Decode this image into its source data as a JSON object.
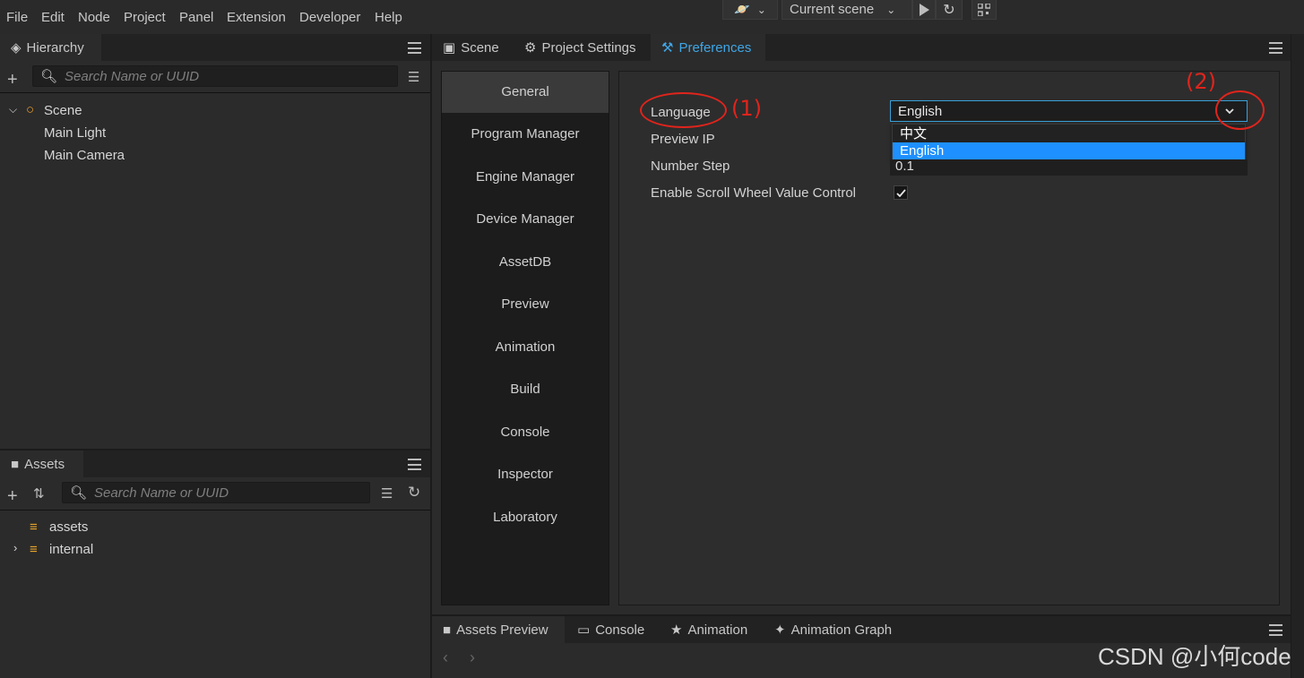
{
  "menubar": {
    "items": [
      "File",
      "Edit",
      "Node",
      "Project",
      "Panel",
      "Extension",
      "Developer",
      "Help"
    ]
  },
  "toolbar": {
    "scene_select": "Current scene"
  },
  "hierarchy": {
    "tab": "Hierarchy",
    "search_placeholder": "Search Name or UUID",
    "tree": [
      {
        "label": "Scene"
      },
      {
        "label": "Main Light"
      },
      {
        "label": "Main Camera"
      }
    ]
  },
  "assets": {
    "tab": "Assets",
    "search_placeholder": "Search Name or UUID",
    "tree": [
      {
        "label": "assets"
      },
      {
        "label": "internal"
      }
    ]
  },
  "center_tabs": [
    "Scene",
    "Project Settings",
    "Preferences"
  ],
  "preferences": {
    "nav": [
      "General",
      "Program Manager",
      "Engine Manager",
      "Device Manager",
      "AssetDB",
      "Preview",
      "Animation",
      "Build",
      "Console",
      "Inspector",
      "Laboratory"
    ],
    "active_nav": "General",
    "fields": {
      "language_label": "Language",
      "language_value": "English",
      "language_options": [
        "中文",
        "English"
      ],
      "preview_ip_label": "Preview IP",
      "number_step_label": "Number Step",
      "number_step_value": "0.1",
      "scroll_label": "Enable Scroll Wheel Value Control",
      "scroll_checked": true
    }
  },
  "annotations": {
    "a1": "(1)",
    "a2": "(2)",
    "color": "#e0241c"
  },
  "bottom_tabs": [
    "Assets Preview",
    "Console",
    "Animation",
    "Animation Graph"
  ],
  "watermark": "CSDN @小何code",
  "colors": {
    "accent": "#3fa6e6",
    "selected": "#1e90ff"
  }
}
